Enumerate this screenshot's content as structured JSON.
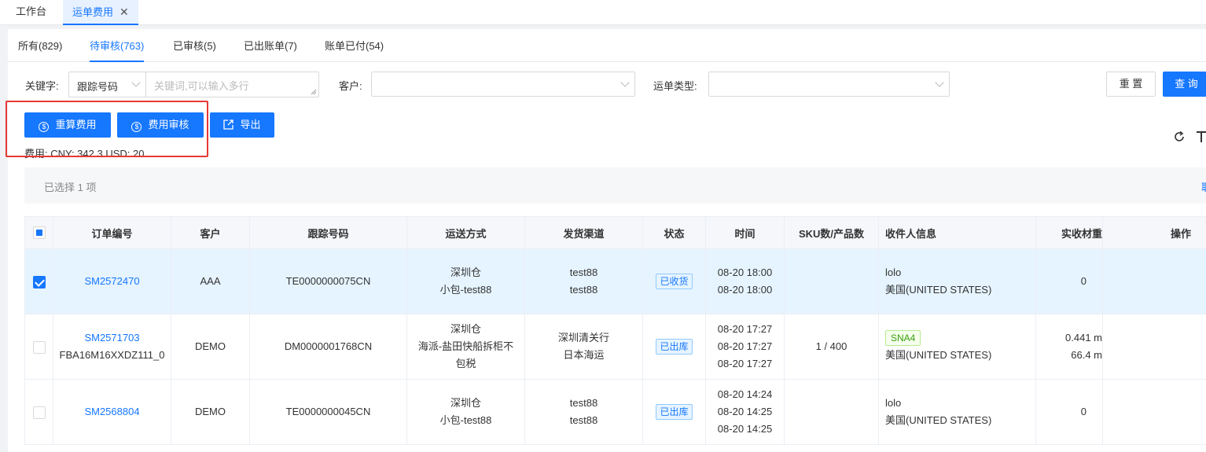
{
  "top_tabs": [
    {
      "label": "工作台"
    },
    {
      "label": "运单费用",
      "close": "✕"
    }
  ],
  "status_tabs": [
    "所有(829)",
    "待审核(763)",
    "已审核(5)",
    "已出账单(7)",
    "账单已付(54)"
  ],
  "filters": {
    "keyword_label": "关键字:",
    "keyword_type": "跟踪号码",
    "keyword_placeholder": "关键词,可以输入多行",
    "customer_label": "客户:",
    "waybill_type_label": "运单类型:"
  },
  "buttons": {
    "reset": "重 置",
    "query": "查 询",
    "recalc": "重算费用",
    "audit": "费用审核",
    "export": "导出"
  },
  "fee_summary": "费用: CNY: 342.3 USD: 20",
  "selection_text": "已选择  1  项",
  "selection_right": "取",
  "table": {
    "headers": [
      "订单编号",
      "客户",
      "跟踪号码",
      "运送方式",
      "发货渠道",
      "状态",
      "时间",
      "SKU数/产品数",
      "收件人信息",
      "实收材重",
      "操作"
    ],
    "rows": [
      {
        "order_no": "SM2572470",
        "order_sub": "",
        "customer": "AAA",
        "tracking": "TE0000000075CN",
        "shipping": [
          "深圳仓",
          "小包-test88"
        ],
        "channel": [
          "test88",
          "test88"
        ],
        "status": "已收货",
        "times": [
          "08-20 18:00",
          "08-20 18:00"
        ],
        "sku": "",
        "recipient_tag": "",
        "recipient": [
          "lolo",
          "美国(UNITED STATES)"
        ],
        "weight": [
          "0"
        ],
        "checked": true
      },
      {
        "order_no": "SM2571703",
        "order_sub": "FBA16M16XXDZ111_0",
        "customer": "DEMO",
        "tracking": "DM0000001768CN",
        "shipping": [
          "深圳仓",
          "海派-盐田快船拆柜不",
          "包税"
        ],
        "channel": [
          "深圳清关行",
          "日本海运"
        ],
        "status": "已出库",
        "times": [
          "08-20 17:27",
          "08-20 17:27",
          "08-20 17:27"
        ],
        "sku": "1 / 400",
        "recipient_tag": "SNA4",
        "recipient": [
          "美国(UNITED STATES)"
        ],
        "weight": [
          "0.441 m",
          "66.4 m"
        ],
        "checked": false
      },
      {
        "order_no": "SM2568804",
        "order_sub": "",
        "customer": "DEMO",
        "tracking": "TE0000000045CN",
        "shipping": [
          "深圳仓",
          "小包-test88"
        ],
        "channel": [
          "test88",
          "test88"
        ],
        "status": "已出库",
        "times": [
          "08-20 14:24",
          "08-20 14:25",
          "08-20 14:25"
        ],
        "sku": "",
        "recipient_tag": "",
        "recipient": [
          "lolo",
          "美国(UNITED STATES)"
        ],
        "weight": [
          "0"
        ],
        "checked": false
      }
    ]
  },
  "colors": {
    "primary": "#1677ff",
    "highlight": "#e53935"
  }
}
